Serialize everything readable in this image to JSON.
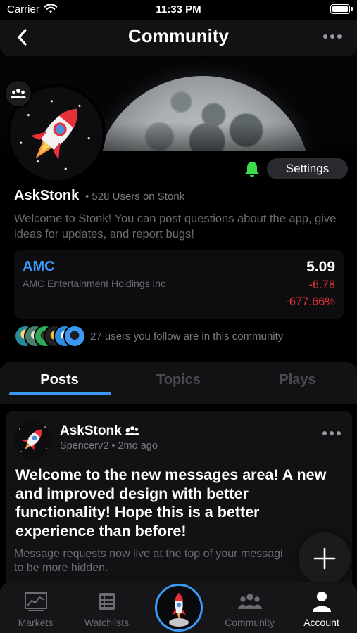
{
  "status_bar": {
    "carrier": "Carrier",
    "time": "11:33 PM"
  },
  "nav": {
    "title": "Community"
  },
  "settings_button": "Settings",
  "community": {
    "name": "AskStonk",
    "meta": "• 528 Users on Stonk",
    "description": "Welcome to Stonk! You can post questions about the app, give ideas for updates, and report bugs!"
  },
  "stock": {
    "ticker": "AMC",
    "company": "AMC Entertainment Holdings Inc",
    "price": "5.09",
    "change": "-6.78",
    "change_pct": "-677.66%",
    "negative_color": "#e8303a",
    "accent_color": "#3b99f5"
  },
  "followers_text": "27 users you follow are in this community",
  "tabs": [
    {
      "label": "Posts",
      "active": true
    },
    {
      "label": "Topics",
      "active": false
    },
    {
      "label": "Plays",
      "active": false
    }
  ],
  "post": {
    "author": "AskStonk •",
    "sub": "Spencerv2 • 2mo ago",
    "title": "Welcome to the new messages area! A new and improved design with better functionality! Hope this is a better experience than before!",
    "body_line1": "Message requests now live at the top of your messagi",
    "body_line2": "to be more hidden."
  },
  "tabbar": [
    {
      "label": "Markets",
      "icon": "markets-chart-icon",
      "active": false
    },
    {
      "label": "Watchlists",
      "icon": "watchlists-icon",
      "active": false
    },
    {
      "label": "",
      "icon": "rocket-icon",
      "active": false
    },
    {
      "label": "Community",
      "icon": "community-icon",
      "active": false
    },
    {
      "label": "Account",
      "icon": "account-icon",
      "active": true
    }
  ]
}
